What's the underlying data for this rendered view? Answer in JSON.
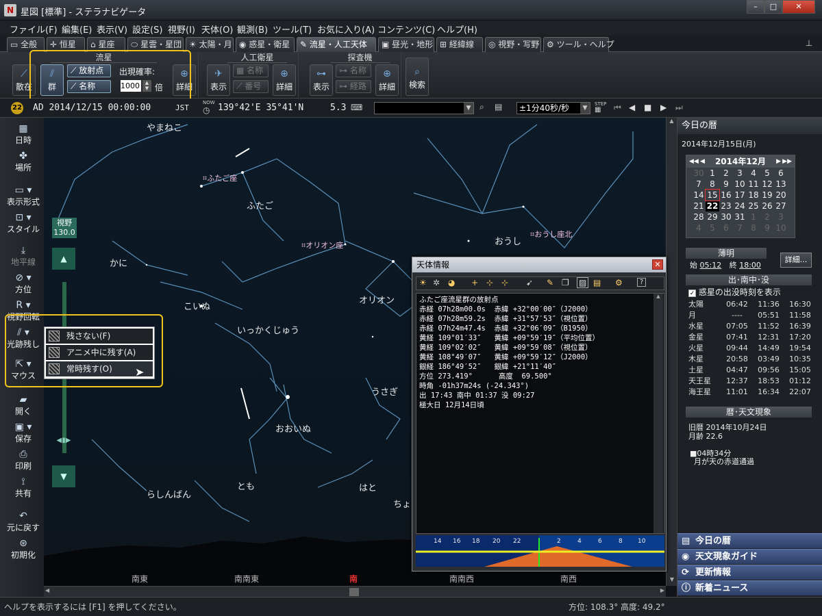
{
  "window": {
    "title": "星図 [標準] - ステラナビゲータ",
    "app_icon": "N"
  },
  "menu": [
    "ファイル(F)",
    "編集(E)",
    "表示(V)",
    "設定(S)",
    "視野(I)",
    "天体(O)",
    "観測(B)",
    "ツール(T)",
    "お気に入り(A)",
    "コンテンツ(C)",
    "ヘルプ(H)"
  ],
  "tabs": [
    "全般",
    "恒星",
    "星座",
    "星雲・星団",
    "太陽・月",
    "惑星・衛星",
    "流星・人工天体",
    "昼光・地形",
    "経緯線",
    "視野・写野",
    "ツール・ヘルプ"
  ],
  "ribbon": {
    "meteor": {
      "title": "流星",
      "scatter": "散在",
      "group": "群",
      "radiant": "放射点",
      "name": "名称",
      "rate_label": "出現確率:",
      "rate_value": "1000",
      "rate_unit": "倍",
      "detail": "詳細"
    },
    "satellite": {
      "title": "人工衛星",
      "show": "表示",
      "name": "名称",
      "number": "番号",
      "detail": "詳細"
    },
    "probe": {
      "title": "探査機",
      "show": "表示",
      "name": "名称",
      "path": "経路",
      "detail": "詳細"
    },
    "search": "検索"
  },
  "toolbar": {
    "date": "AD 2014/12/15 00:00:00",
    "tz": "JST",
    "now": "NOW",
    "location": "139°42'E 35°41'N",
    "magnitude": "5.3",
    "step": "±1分40秒/秒",
    "step_label": "STEP"
  },
  "left": [
    "日時",
    "場所",
    "表示形式",
    "スタイル",
    "地平線",
    "方位",
    "視野回転",
    "光跡残し",
    "マウス",
    "開く",
    "保存",
    "印刷",
    "共有",
    "元に戻す",
    "初期化"
  ],
  "fov": {
    "label": "視野",
    "value": "130.0"
  },
  "sky": {
    "constellations": [
      "やまねこ",
      "ふたご",
      "かに",
      "こいぬ",
      "いっかくじゅう",
      "オリオン",
      "おうし",
      "うさぎ",
      "おおいぬ",
      "らしんばん",
      "とも",
      "はと",
      "ちょう"
    ],
    "showers": [
      "ふたご座",
      "オリオン座",
      "おうし座北"
    ],
    "directions": [
      "南東",
      "南南東",
      "南",
      "南南西",
      "南西"
    ],
    "direction_colors": {
      "south": "#e23030"
    }
  },
  "popup": {
    "items": [
      "残さない(F)",
      "アニメ中に残す(A)",
      "常時残す(O)"
    ]
  },
  "info": {
    "title": "天体情報",
    "lines": [
      "ふたご座流星群の放射点",
      "赤経 07h28m00.0s  赤緯 +32°00′00″（J2000）",
      "赤経 07h28m59.2s  赤緯 +31°57′53″（視位置）",
      "赤経 07h24m47.4s  赤緯 +32°06′09″（B1950）",
      "黄経 109°01′33″   黄緯 +09°59′19″（平均位置）",
      "黄経 109°02′02″   黄緯 +09°59′08″（視位置）",
      "黄経 108°49′07″   黄緯 +09°59′12″（J2000）",
      "銀経 186°49′52″   銀緯 +21°11′40″",
      "方位 273.419°      高度  69.500°",
      "時角 -01h37m24s (-24.343°)",
      "出 17:43 南中 01:37 没 09:27",
      "極大日 12月14日頃"
    ],
    "plot_hours": [
      "14",
      "16",
      "18",
      "20",
      "22",
      "2",
      "4",
      "6",
      "8",
      "10"
    ]
  },
  "right": {
    "title": "今日の暦",
    "date": "2014年12月15日(月)",
    "month": "2014年12月",
    "cal": [
      [
        "30",
        "1",
        "2",
        "3",
        "4",
        "5",
        "6"
      ],
      [
        "7",
        "8",
        "9",
        "10",
        "11",
        "12",
        "13"
      ],
      [
        "14",
        "15",
        "16",
        "17",
        "18",
        "19",
        "20"
      ],
      [
        "21",
        "22",
        "23",
        "24",
        "25",
        "26",
        "27"
      ],
      [
        "28",
        "29",
        "30",
        "31",
        "1",
        "2",
        "3"
      ],
      [
        "4",
        "5",
        "6",
        "7",
        "8",
        "9",
        "10"
      ]
    ],
    "twilight": "薄明",
    "start_label": "始",
    "start": "05:12",
    "end_label": "終",
    "end": "18:00",
    "detail": "詳細...",
    "rise_title": "出･南中･没",
    "rise_check": "惑星の出没時刻を表示",
    "rise": [
      [
        "太陽",
        "06:42",
        "11:36",
        "16:30"
      ],
      [
        "月",
        "----",
        "05:51",
        "11:58"
      ],
      [
        "水星",
        "07:05",
        "11:52",
        "16:39"
      ],
      [
        "金星",
        "07:41",
        "12:31",
        "17:20"
      ],
      [
        "火星",
        "09:44",
        "14:49",
        "19:54"
      ],
      [
        "木星",
        "20:58",
        "03:49",
        "10:35"
      ],
      [
        "土星",
        "04:47",
        "09:56",
        "15:05"
      ],
      [
        "天王星",
        "12:37",
        "18:53",
        "01:12"
      ],
      [
        "海王星",
        "11:01",
        "16:34",
        "22:07"
      ]
    ],
    "koyomi_title": "暦･天文現象",
    "old": "旧暦 2014年10月24日",
    "age": "月齢 22.6",
    "event_time": "■04時34分",
    "event": "月が天の赤道通過",
    "acc": [
      "今日の暦",
      "天文現象ガイド",
      "更新情報",
      "新着ニュース"
    ]
  },
  "status": {
    "help": "ヘルプを表示するには [F1] を押してください。",
    "pos": "方位: 108.3° 高度: 49.2°"
  },
  "colors": {
    "highlight": "#f2c21d",
    "sky": "#0d1b28",
    "horizon": "#e06a2a"
  }
}
